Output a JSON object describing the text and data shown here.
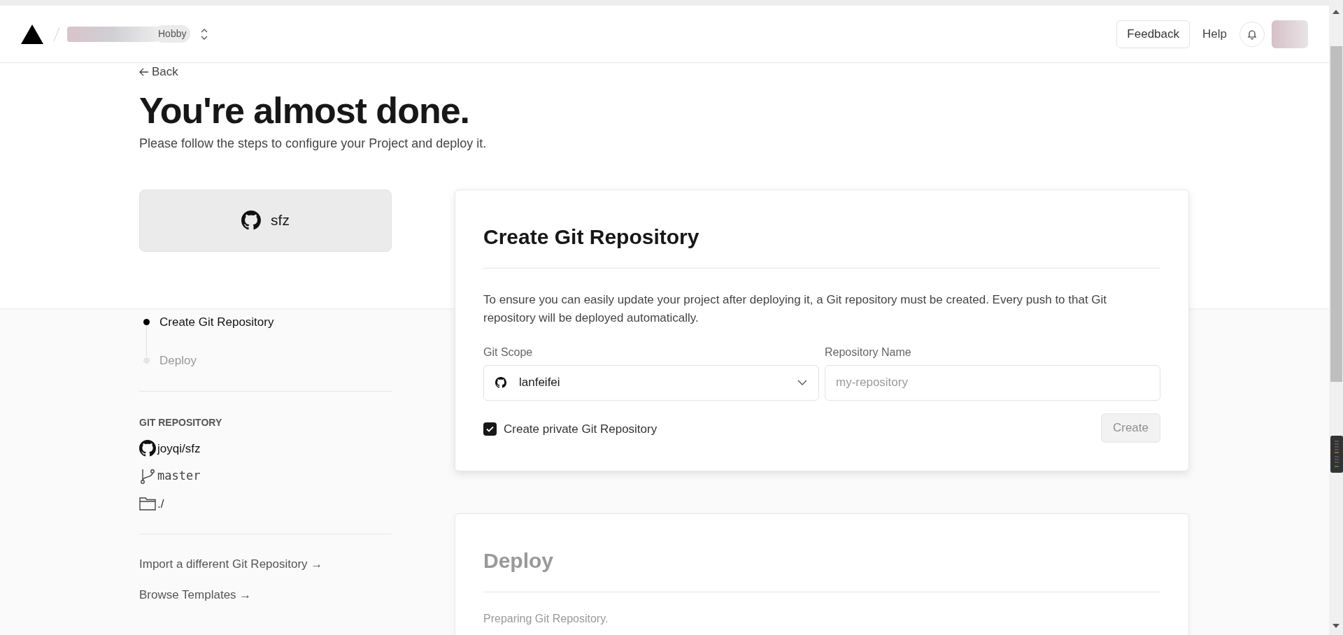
{
  "header": {
    "plan_badge": "Hobby",
    "buttons": [
      {
        "label": "Feedback",
        "kind": "outlined"
      },
      {
        "label": "Help",
        "kind": "text"
      }
    ]
  },
  "back_link": "Back",
  "title": "You're almost done.",
  "subtitle": "Please follow the steps to configure your Project and deploy it.",
  "repo_card": {
    "name": "sfz"
  },
  "steps": [
    {
      "label": "Create Git Repository",
      "selected": true
    },
    {
      "label": "Deploy",
      "selected": false
    }
  ],
  "git_repository": {
    "heading": "GIT REPOSITORY",
    "items": [
      {
        "kind": "repo",
        "text": "joyqi/sfz"
      },
      {
        "kind": "branch",
        "text": "master"
      },
      {
        "kind": "folder",
        "text": "./"
      }
    ]
  },
  "links": [
    "Import a different Git Repository →",
    "Browse Templates →"
  ],
  "create_card": {
    "title": "Create Git Repository",
    "description": "To ensure you can easily update your project after deploying it, a Git repository must be created. Every push to that Git repository will be deployed automatically.",
    "scope": {
      "label": "Git Scope",
      "value": "lanfeifei"
    },
    "repo_name": {
      "label": "Repository Name",
      "placeholder": "my-repository"
    },
    "private": {
      "label": "Create private Git Repository",
      "checked": true
    },
    "button": {
      "label": "Create",
      "disabled": true
    }
  },
  "deploy_card": {
    "title": "Deploy",
    "text": "Preparing Git Repository.",
    "disabled": true
  }
}
